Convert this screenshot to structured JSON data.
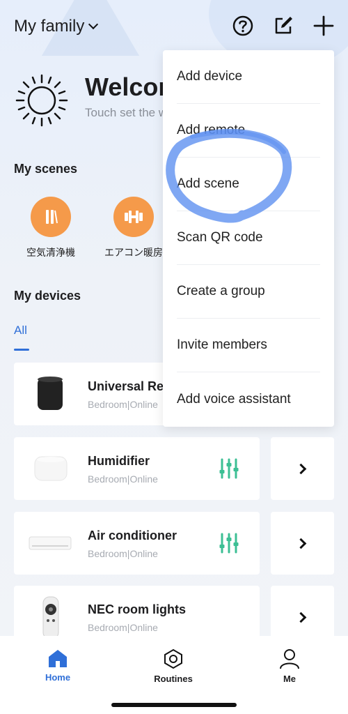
{
  "header": {
    "family_label": "My family"
  },
  "welcome": {
    "title": "Welcome home",
    "subtitle": "Touch set the weather"
  },
  "scenes": {
    "heading": "My scenes",
    "items": [
      {
        "label": "空気清浄機",
        "icon": "pause-bars-icon",
        "color": "#f59a4a"
      },
      {
        "label": "エアコン暖房",
        "icon": "dumbbell-icon",
        "color": "#f59a4a"
      }
    ]
  },
  "devices": {
    "heading": "My devices",
    "tab_all": "All",
    "items": [
      {
        "name": "Universal Remote",
        "status": "Bedroom|Online",
        "icon": "universal-remote-device"
      },
      {
        "name": "Humidifier",
        "status": "Bedroom|Online",
        "icon": "humidifier-device"
      },
      {
        "name": "Air conditioner",
        "status": "Bedroom|Online",
        "icon": "air-conditioner-device"
      },
      {
        "name": "NEC room lights",
        "status": "Bedroom|Online",
        "icon": "remote-control-device"
      }
    ]
  },
  "menu": {
    "items": [
      "Add device",
      "Add remote",
      "Add scene",
      "Scan QR code",
      "Create a group",
      "Invite members",
      "Add voice assistant"
    ]
  },
  "nav": {
    "home": "Home",
    "routines": "Routines",
    "me": "Me"
  },
  "colors": {
    "accent": "#2f6fd8",
    "scene": "#f59a4a",
    "control": "#3cbf94",
    "scribble": "#5b8ef0"
  }
}
